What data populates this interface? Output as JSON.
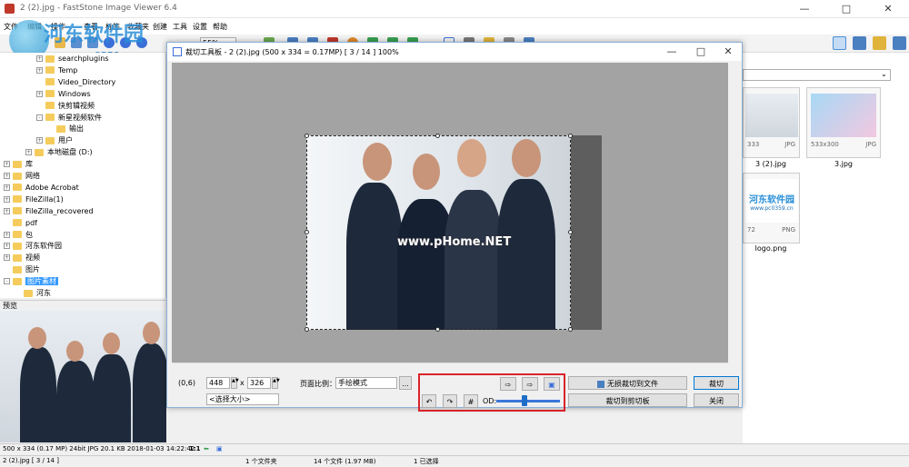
{
  "app": {
    "title": "2 (2).jpg - FastStone Image Viewer 6.4"
  },
  "watermark": {
    "title": "河东软件园",
    "url": "www.pc0359.cn"
  },
  "menu": [
    "文件",
    "编辑",
    "操作",
    "查看",
    "标签",
    "收藏夹",
    "创建",
    "工具",
    "设置",
    "帮助"
  ],
  "toolbar": {
    "zoom": "55%"
  },
  "tree": [
    {
      "label": "searchplugins",
      "indent": 3,
      "exp": "+"
    },
    {
      "label": "Temp",
      "indent": 3,
      "exp": "+"
    },
    {
      "label": "Video_Directory",
      "indent": 3,
      "exp": ""
    },
    {
      "label": "Windows",
      "indent": 3,
      "exp": "+"
    },
    {
      "label": "快剪辑视频",
      "indent": 3,
      "exp": ""
    },
    {
      "label": "新星视频软件",
      "indent": 3,
      "exp": "-"
    },
    {
      "label": "输出",
      "indent": 4,
      "exp": ""
    },
    {
      "label": "用户",
      "indent": 3,
      "exp": "+"
    },
    {
      "label": "本地磁盘 (D:)",
      "indent": 2,
      "exp": "+"
    },
    {
      "label": "库",
      "indent": 0,
      "exp": "+"
    },
    {
      "label": "网络",
      "indent": 0,
      "exp": "+"
    },
    {
      "label": "Adobe Acrobat",
      "indent": 0,
      "exp": "+"
    },
    {
      "label": "FileZilla(1)",
      "indent": 0,
      "exp": "+"
    },
    {
      "label": "FileZilla_recovered",
      "indent": 0,
      "exp": "+"
    },
    {
      "label": "pdf",
      "indent": 0,
      "exp": ""
    },
    {
      "label": "包",
      "indent": 0,
      "exp": "+"
    },
    {
      "label": "河东软件园",
      "indent": 0,
      "exp": "+"
    },
    {
      "label": "视频",
      "indent": 0,
      "exp": "+"
    },
    {
      "label": "图片",
      "indent": 0,
      "exp": ""
    },
    {
      "label": "图片素材",
      "indent": 0,
      "exp": "-",
      "selected": true
    },
    {
      "label": "河东",
      "indent": 1,
      "exp": ""
    }
  ],
  "preview": {
    "label": "预览"
  },
  "thumbs": [
    {
      "res": "333",
      "fmt": "JPG",
      "name": "3 (2).jpg"
    },
    {
      "res": "533x300",
      "fmt": "JPG",
      "name": "3.jpg"
    },
    {
      "res": "72",
      "fmt": "PNG",
      "name": "logo.png"
    }
  ],
  "dialog": {
    "title": "裁切工具板  -  2 (2).jpg   (500 x 334 = 0.17MP)   [ 3 / 14 ]   100%",
    "watermark": "www.pHome.NET",
    "coord": "(0,6)",
    "width": "448",
    "height": "326",
    "x_sep": "x",
    "size_select": "<选择大小>",
    "ratio_label": "页面比例：",
    "ratio_value": "手绘模式",
    "ratio_more": "...",
    "od_label": "OD:",
    "save_lossless": "无损裁切到文件",
    "crop": "裁切",
    "crop_clipboard": "裁切到剪切板",
    "close": "关闭"
  },
  "status": {
    "info": "500 x 334 (0.17 MP)   24bit   JPG   20.1 KB   2018-01-03 14:22:42",
    "zoom": "1:1",
    "file": "2 (2).jpg [ 3 / 14 ]",
    "folders": "1 个文件夹",
    "files": "14 个文件 (1.97 MB)",
    "selected": "1 已选择"
  }
}
